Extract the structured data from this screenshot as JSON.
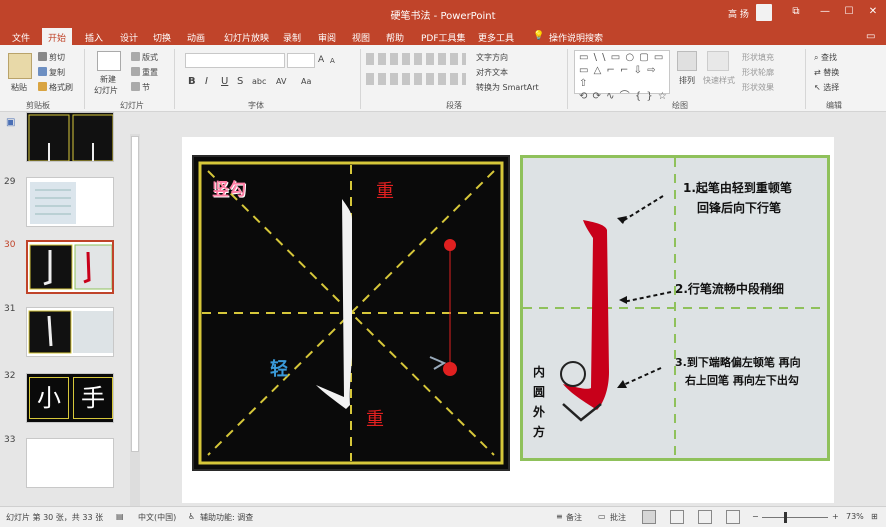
{
  "window": {
    "title": "硬笔书法 - PowerPoint",
    "user": "高 扬",
    "controls": {
      "ribbon_display": "⧉",
      "minimize": "—",
      "maximize": "☐",
      "close": "✕"
    }
  },
  "tabs": [
    "文件",
    "开始",
    "插入",
    "设计",
    "切换",
    "动画",
    "幻灯片放映",
    "录制",
    "审阅",
    "视图",
    "帮助",
    "PDF工具集",
    "更多工具"
  ],
  "active_tab": "开始",
  "tell_me": "操作说明搜索",
  "share_icon": "comment-icon",
  "ribbon": {
    "clipboard": {
      "label": "剪贴板",
      "paste": "粘贴",
      "cut": "剪切",
      "copy": "复制",
      "format_painter": "格式刷"
    },
    "slides": {
      "label": "幻灯片",
      "new_slide": "新建",
      "new_slide2": "幻灯片",
      "layout": "版式",
      "reset": "重置",
      "section": "节"
    },
    "font": {
      "label": "字体",
      "bold": "B",
      "italic": "I",
      "underline": "U",
      "strike": "S",
      "shadow": "abc",
      "spacing": "AV",
      "case": "Aa",
      "grow": "A",
      "shrink": "A"
    },
    "paragraph": {
      "label": "段落",
      "text_direction": "文字方向",
      "align_text": "对齐文本",
      "smartart": "转换为 SmartArt"
    },
    "drawing": {
      "label": "绘图",
      "shapes_row1": "▭ \\ \\ ▭ ○ ▢ ▭",
      "shapes_row2": "▭ △ ⌐ ⌐ ⇩ ⇨ ⇧",
      "shapes_row3": "⟲ ⟳ ∿ ⌒ { } ☆",
      "arrange": "排列",
      "quick_styles": "快速样式",
      "fill": "形状填充",
      "outline": "形状轮廓",
      "effects": "形状效果"
    },
    "editing": {
      "label": "编辑",
      "find": "查找",
      "replace": "替换",
      "select": "选择"
    }
  },
  "thumbnails": [
    {
      "num": "29"
    },
    {
      "num": "30"
    },
    {
      "num": "31"
    },
    {
      "num": "32",
      "chars": [
        "小",
        "手"
      ]
    },
    {
      "num": "33"
    }
  ],
  "selected_slide": "30",
  "slide": {
    "blackboard": {
      "title": "竖勾",
      "top_mark": "重",
      "left_mark": "轻",
      "bottom_mark": "重"
    },
    "greenboard": {
      "step1_a": "1.起笔由轻到重顿笔",
      "step1_b": "回锋后向下行笔",
      "step2": "2.行笔流畅中段稍细",
      "step3_a": "3.到下端略偏左顿笔 再向",
      "step3_b": "右上回笔 再向左下出勾",
      "side1": "内",
      "side2": "圆",
      "side3": "外",
      "side4": "方"
    }
  },
  "status": {
    "slide_info": "幻灯片 第 30 张，共 33 张",
    "language": "中文(中国)",
    "accessibility": "辅助功能: 调查",
    "notes": "备注",
    "comments": "批注",
    "zoom": "73%",
    "zoom_level": 0.73
  },
  "colors": {
    "accent": "#c0442a",
    "red_mark": "#e02020",
    "blue_mark": "#3a9ad8",
    "grid_yellow": "#d6c73a",
    "board_green": "#8fc15b",
    "stroke_red": "#c8001a"
  }
}
